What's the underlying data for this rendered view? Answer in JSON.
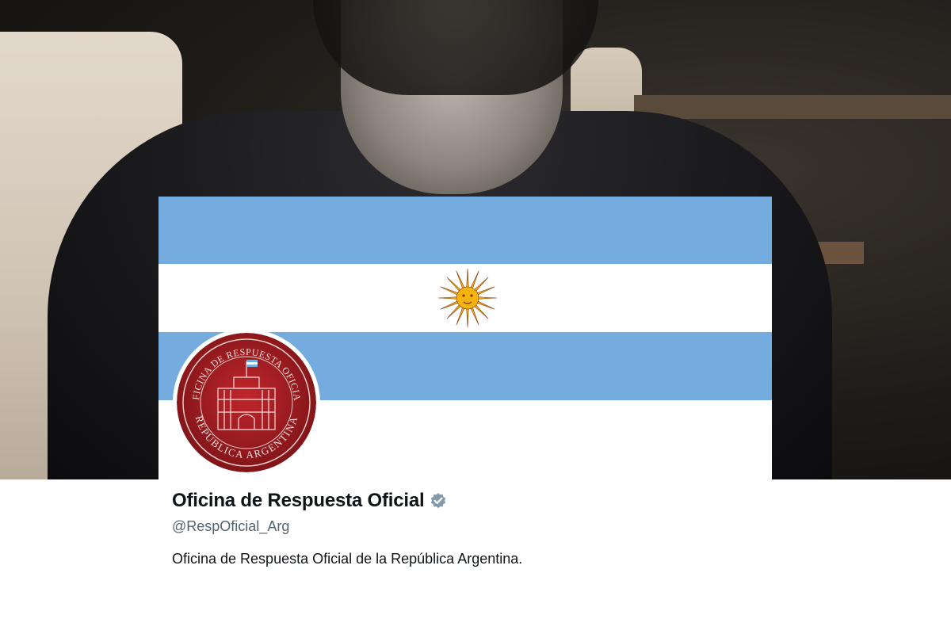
{
  "profile": {
    "display_name": "Oficina de Respuesta Oficial",
    "handle": "@RespOficial_Arg",
    "bio": "Oficina de Respuesta Oficial de la República Argentina.",
    "verified": true,
    "verified_badge_color": "#829aab"
  },
  "banner": {
    "stripe_color": "#74acdf",
    "center_color": "#ffffff",
    "sun_icon": "sol-de-mayo-icon"
  },
  "avatar": {
    "seal_top_text": "OFICINA DE RESPUESTA OFICIAL",
    "seal_bottom_text": "REPÚBLICA ARGENTINA",
    "seal_color": "#9b1b1e"
  }
}
